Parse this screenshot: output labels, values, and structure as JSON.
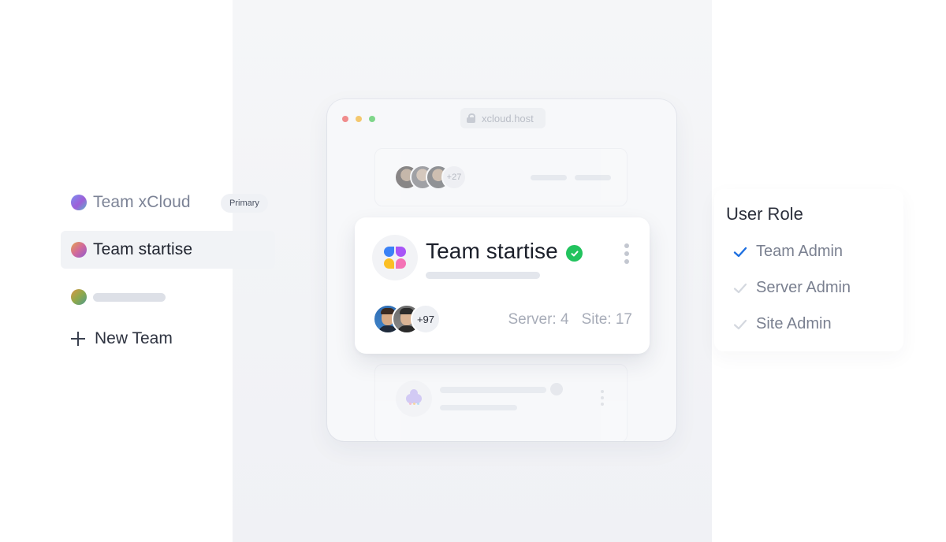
{
  "teams": {
    "items": [
      {
        "label": "Team xCloud",
        "badge": "Primary"
      },
      {
        "label": "Team startise"
      }
    ],
    "new_team_label": "New Team"
  },
  "browser": {
    "url": "xcloud.host"
  },
  "ghost_card": {
    "more_members": "+27"
  },
  "card": {
    "title": "Team startise",
    "more_members": "+97",
    "server_text": "Server: 4",
    "site_text": "Site: 17"
  },
  "roles": {
    "title": "User Role",
    "items": [
      {
        "label": "Team Admin",
        "checked": true
      },
      {
        "label": "Server Admin",
        "checked": false
      },
      {
        "label": "Site Admin",
        "checked": false
      }
    ]
  },
  "colors": {
    "verified": "#22c35e",
    "check_active": "#1d6fe0",
    "check_inactive": "#d4d8df"
  }
}
